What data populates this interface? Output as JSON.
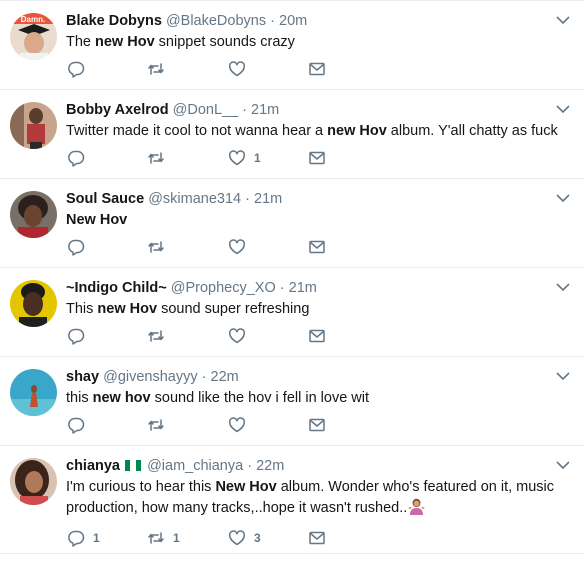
{
  "tweets": [
    {
      "name": "Blake Dobyns",
      "handle": "@BlakeDobyns",
      "dot": "·",
      "time": "20m",
      "text": [
        {
          "t": "The ",
          "b": false
        },
        {
          "t": "new Hov",
          "b": true
        },
        {
          "t": " snippet sounds crazy",
          "b": false
        }
      ],
      "replies": "",
      "retweets": "",
      "likes": ""
    },
    {
      "name": "Bobby Axelrod",
      "handle": "@DonL__",
      "dot": "·",
      "time": "21m",
      "text": [
        {
          "t": "Twitter made it cool to not wanna hear a ",
          "b": false
        },
        {
          "t": "new Hov",
          "b": true
        },
        {
          "t": " album. Y'all chatty as fuck",
          "b": false
        }
      ],
      "replies": "",
      "retweets": "",
      "likes": "1"
    },
    {
      "name": "Soul Sauce",
      "handle": "@skimane314",
      "dot": "·",
      "time": "21m",
      "text": [
        {
          "t": "New Hov",
          "b": true
        }
      ],
      "replies": "",
      "retweets": "",
      "likes": ""
    },
    {
      "name": "~Indigo Child~",
      "handle": "@Prophecy_XO",
      "dot": "·",
      "time": "21m",
      "text": [
        {
          "t": "This ",
          "b": false
        },
        {
          "t": "new Hov",
          "b": true
        },
        {
          "t": " sound super refreshing",
          "b": false
        }
      ],
      "replies": "",
      "retweets": "",
      "likes": ""
    },
    {
      "name": "shay",
      "handle": "@givenshayyy",
      "dot": "·",
      "time": "22m",
      "text": [
        {
          "t": "this ",
          "b": false
        },
        {
          "t": "new hov",
          "b": true
        },
        {
          "t": " sound like the hov i fell in love wit",
          "b": false
        }
      ],
      "replies": "",
      "retweets": "",
      "likes": ""
    },
    {
      "name": "chianya",
      "handle": "@iam_chianya",
      "dot": "·",
      "time": "22m",
      "flag": true,
      "text": [
        {
          "t": "I'm curious to hear this ",
          "b": false
        },
        {
          "t": "New Hov",
          "b": true
        },
        {
          "t": " album. Wonder who's featured on it, music production, how many tracks,..hope it wasn't rushed..",
          "b": false
        }
      ],
      "emoji": "woman-shrugging-emoji",
      "replies": "1",
      "retweets": "1",
      "likes": "3"
    }
  ],
  "icons": {
    "reply": "reply-icon",
    "retweet": "retweet-icon",
    "like": "heart-icon",
    "dm": "direct-message-icon",
    "caret": "chevron-down-icon"
  },
  "colors": {
    "icon": "#657786",
    "divider": "#e6ecf0",
    "name": "#14171a",
    "meta": "#657786",
    "flag_green": "#008751",
    "flag_white": "#ffffff"
  }
}
